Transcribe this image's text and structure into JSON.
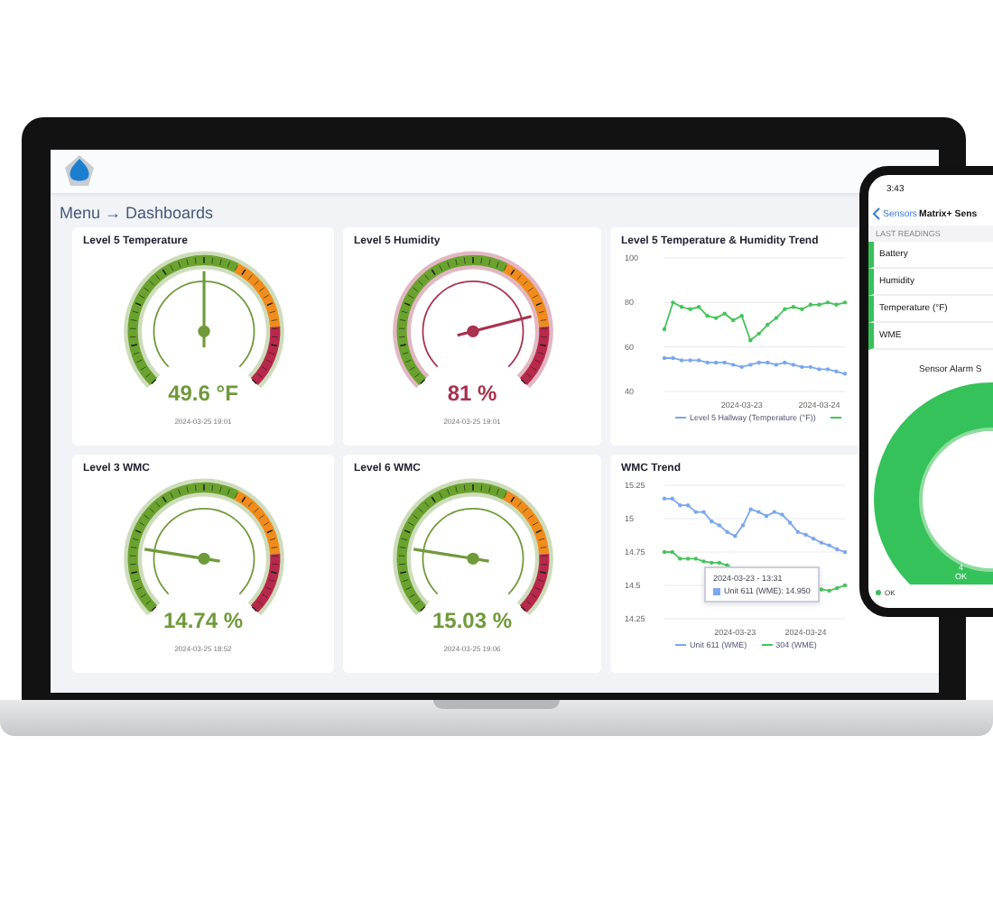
{
  "breadcrumb": "Menu → Dashboards",
  "gauges": [
    {
      "title": "Level 5 Temperature",
      "value": "49.6 °F",
      "color": "#6f9a3a",
      "time": "2024-03-25 19:01"
    },
    {
      "title": "Level 5 Humidity",
      "value": "81 %",
      "color": "#a8324f",
      "time": "2024-03-25 19:01"
    },
    {
      "title": "Level 3 WMC",
      "value": "14.74 %",
      "color": "#6f9a3a",
      "time": "2024-03-25 18:52"
    },
    {
      "title": "Level 6 WMC",
      "value": "15.03 %",
      "color": "#6f9a3a",
      "time": "2024-03-25 19:06"
    }
  ],
  "trends": [
    {
      "title": "Level 5 Temperature & Humidity Trend",
      "chart_data": {
        "type": "line",
        "grid": true,
        "ylim": [
          40,
          100
        ],
        "yticks": [
          40,
          60,
          80,
          100
        ],
        "categories": [
          null,
          null,
          null,
          null,
          null,
          null,
          null,
          null,
          null,
          "2024-03-23",
          null,
          null,
          null,
          null,
          null,
          null,
          null,
          null,
          "2024-03-24",
          null,
          null,
          null
        ],
        "series": [
          {
            "name": "Level 5 Hallway (Temperature (°F))",
            "color": "#7aa7ee",
            "values": [
              55,
              55,
              54,
              54,
              54,
              53,
              53,
              53,
              52,
              51,
              52,
              53,
              53,
              52,
              53,
              52,
              51,
              51,
              50,
              50,
              49,
              48
            ]
          },
          {
            "color": "#45c45a",
            "values": [
              68,
              80,
              78,
              77,
              78,
              74,
              73,
              75,
              72,
              74,
              63,
              66,
              70,
              73,
              77,
              78,
              77,
              79,
              79,
              80,
              79,
              80
            ]
          }
        ]
      }
    },
    {
      "title": "WMC Trend",
      "chart_data": {
        "type": "line",
        "grid": true,
        "ylim": [
          14.25,
          15.25
        ],
        "yticks": [
          14.25,
          14.5,
          14.75,
          15,
          15.25
        ],
        "categories": [
          null,
          null,
          null,
          null,
          null,
          null,
          null,
          null,
          null,
          "2024-03-23",
          null,
          null,
          null,
          null,
          null,
          null,
          null,
          null,
          "2024-03-24",
          null,
          null,
          null,
          null,
          null
        ],
        "series": [
          {
            "name": "Unit 611 (WME)",
            "color": "#7aa7ee",
            "values": [
              15.15,
              15.15,
              15.1,
              15.1,
              15.05,
              15.05,
              14.98,
              14.95,
              14.9,
              14.87,
              14.95,
              15.07,
              15.05,
              15.02,
              15.05,
              15.03,
              14.97,
              14.9,
              14.88,
              14.85,
              14.82,
              14.8,
              14.77,
              14.75
            ]
          },
          {
            "name": "304 (WME)",
            "color": "#45c45a",
            "values": [
              14.75,
              14.75,
              14.7,
              14.7,
              14.7,
              14.68,
              14.67,
              14.67,
              14.65,
              14.62,
              null,
              null,
              null,
              null,
              null,
              null,
              null,
              null,
              null,
              null,
              14.47,
              14.46,
              14.48,
              14.5
            ]
          }
        ]
      },
      "tooltip": {
        "time": "2024-03-23 - 13:31",
        "label": "Unit 611 (WME): 14.950"
      }
    }
  ],
  "phone": {
    "time": "3:43",
    "back": "Sensors",
    "title": "Matrix+ Sens",
    "section": "LAST READINGS",
    "readings": [
      "Battery",
      "Humidity",
      "Temperature (°F)",
      "WME"
    ],
    "chart_title": "Sensor Alarm S",
    "donut_count": "4",
    "donut_label": "OK",
    "legend": "OK"
  }
}
